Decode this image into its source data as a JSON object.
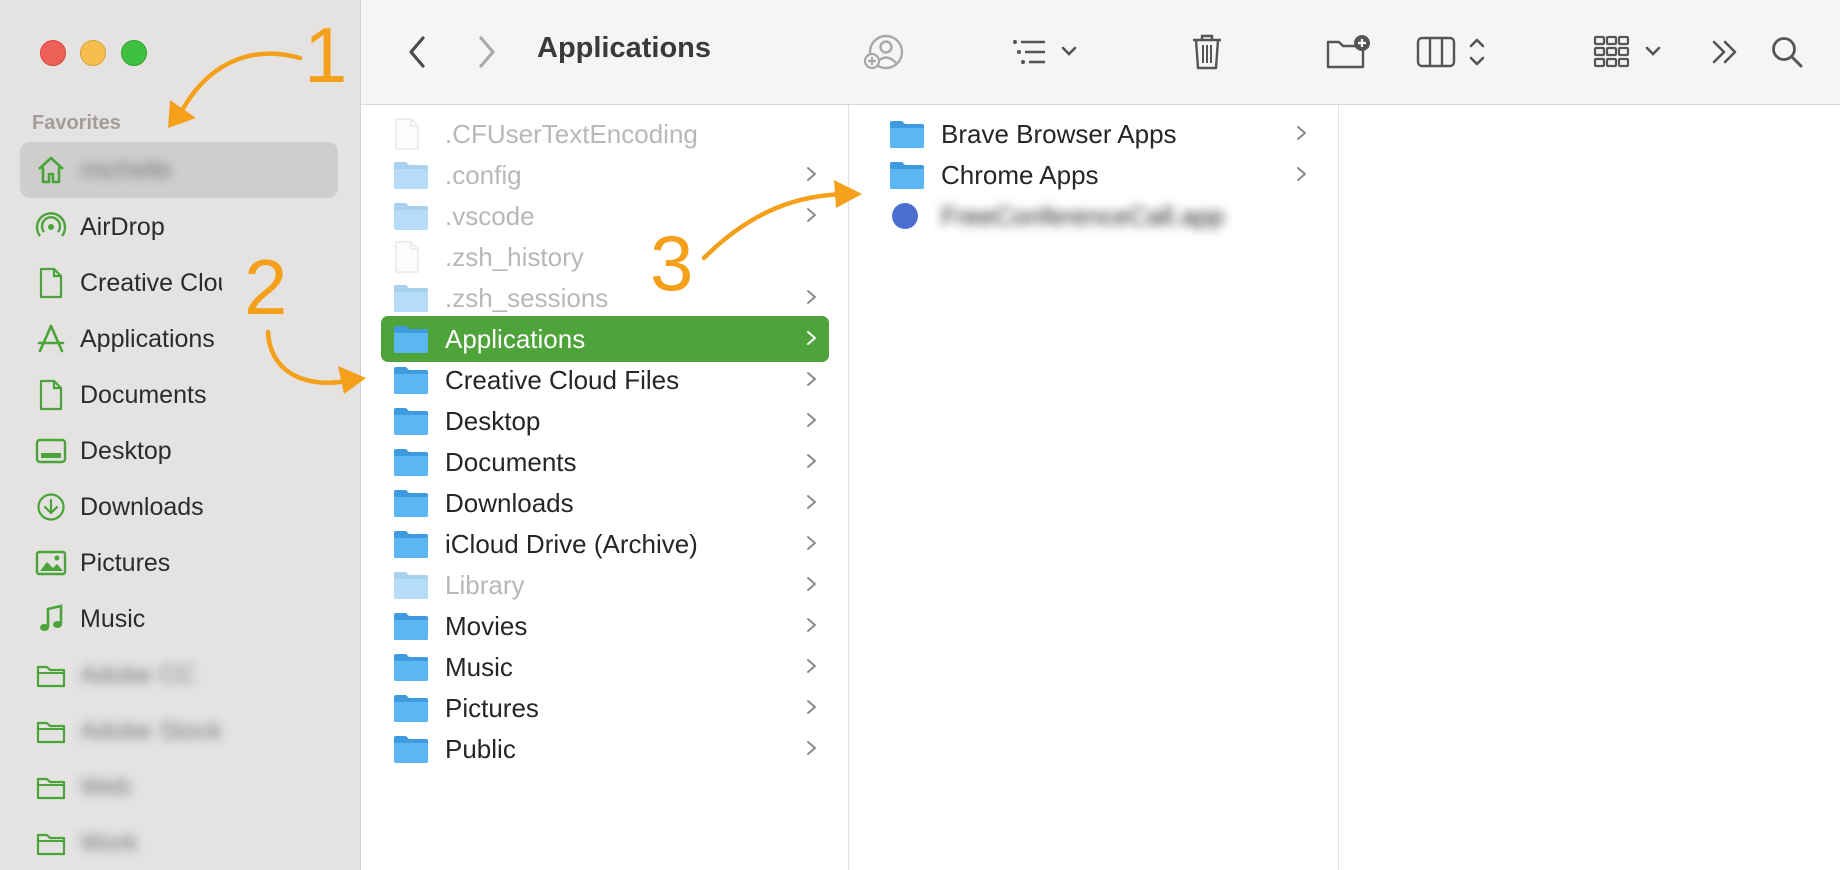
{
  "toolbar": {
    "title": "Applications"
  },
  "sidebar": {
    "section_title": "Favorites",
    "items": [
      {
        "label": "michelle",
        "icon": "home-icon",
        "blurred": true,
        "selected": true
      },
      {
        "label": "AirDrop",
        "icon": "airdrop-icon"
      },
      {
        "label": "Creative Cloud Files",
        "icon": "document-icon"
      },
      {
        "label": "Applications",
        "icon": "applications-icon"
      },
      {
        "label": "Documents",
        "icon": "document-icon"
      },
      {
        "label": "Desktop",
        "icon": "desktop-icon"
      },
      {
        "label": "Downloads",
        "icon": "downloads-icon"
      },
      {
        "label": "Pictures",
        "icon": "pictures-icon"
      },
      {
        "label": "Music",
        "icon": "music-icon"
      },
      {
        "label": "Adobe CC",
        "icon": "folder-icon",
        "blurred": true
      },
      {
        "label": "Adobe Stock",
        "icon": "folder-icon",
        "blurred": true
      },
      {
        "label": "Web",
        "icon": "folder-icon",
        "blurred": true
      },
      {
        "label": "Work",
        "icon": "folder-icon",
        "blurred": true
      }
    ]
  },
  "column1": [
    {
      "label": ".CFUserTextEncoding",
      "type": "file",
      "hidden": true,
      "chevron": false
    },
    {
      "label": ".config",
      "type": "folder",
      "hidden": true,
      "chevron": true
    },
    {
      "label": ".vscode",
      "type": "folder",
      "hidden": true,
      "chevron": true
    },
    {
      "label": ".zsh_history",
      "type": "file",
      "hidden": true,
      "chevron": false
    },
    {
      "label": ".zsh_sessions",
      "type": "folder",
      "hidden": true,
      "chevron": true
    },
    {
      "label": "Applications",
      "type": "folder",
      "selected": true,
      "chevron": true
    },
    {
      "label": "Creative Cloud Files",
      "type": "folder",
      "chevron": true
    },
    {
      "label": "Desktop",
      "type": "folder",
      "chevron": true
    },
    {
      "label": "Documents",
      "type": "folder",
      "chevron": true
    },
    {
      "label": "Downloads",
      "type": "folder",
      "chevron": true
    },
    {
      "label": "iCloud Drive (Archive)",
      "type": "folder",
      "chevron": true
    },
    {
      "label": "Library",
      "type": "folder",
      "hidden": true,
      "chevron": true
    },
    {
      "label": "Movies",
      "type": "folder",
      "chevron": true
    },
    {
      "label": "Music",
      "type": "folder",
      "chevron": true
    },
    {
      "label": "Pictures",
      "type": "folder",
      "chevron": true
    },
    {
      "label": "Public",
      "type": "folder",
      "chevron": true
    }
  ],
  "column2": [
    {
      "label": "Brave Browser Apps",
      "type": "folder",
      "chevron": true
    },
    {
      "label": "Chrome Apps",
      "type": "folder",
      "chevron": true
    },
    {
      "label": "FreeConferenceCall.app",
      "type": "app",
      "blurred": true,
      "chevron": false
    }
  ],
  "annotations": [
    "1",
    "2",
    "3"
  ],
  "colors": {
    "selection": "#4ea33b",
    "annotation": "#f5a01a",
    "sidebar_icon": "#4aa43a",
    "folder": "#5cb6f2"
  }
}
